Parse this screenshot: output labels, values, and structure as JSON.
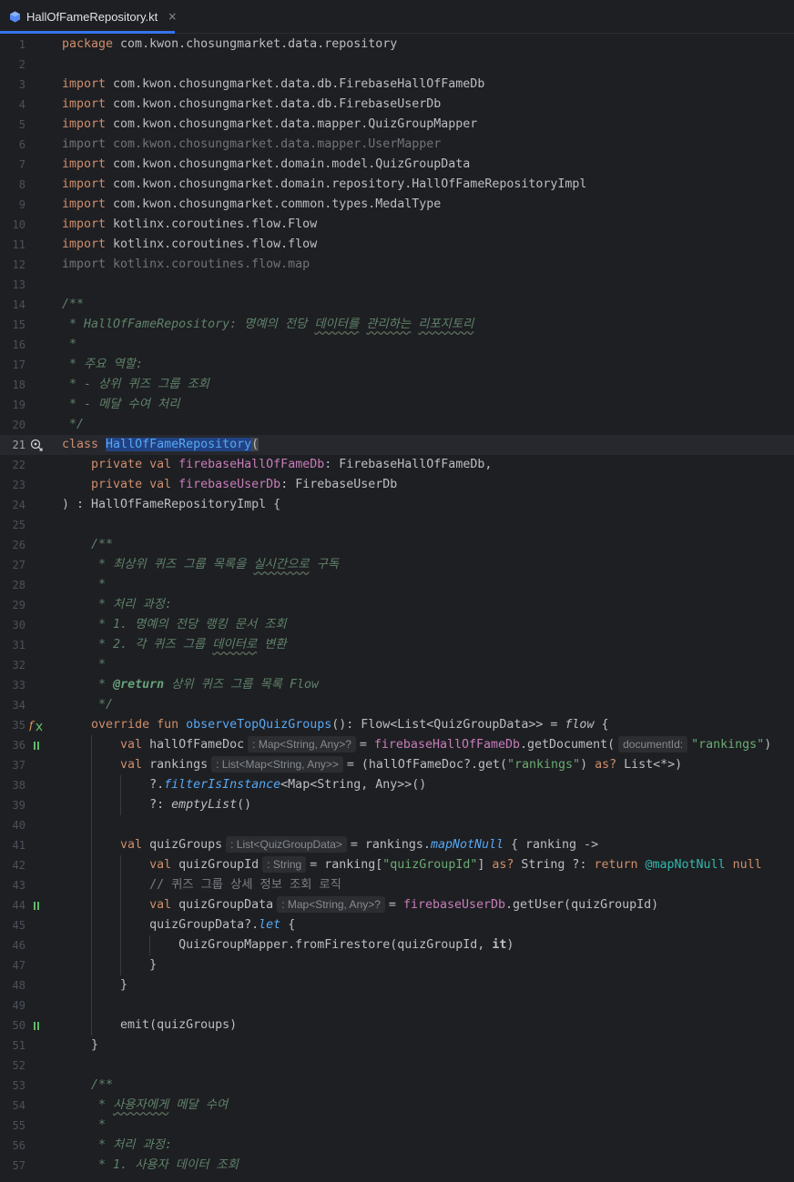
{
  "tab": {
    "filename": "HallOfFameRepository.kt",
    "close_glyph": "×",
    "icon": "kotlin-file-icon"
  },
  "lines": [
    {
      "n": "1",
      "code": [
        [
          "kw",
          "package"
        ],
        [
          "",
          "com.kwon.chosungmarket.data.repository"
        ]
      ]
    },
    {
      "n": "2",
      "code": []
    },
    {
      "n": "3",
      "code": [
        [
          "kw",
          "import"
        ],
        [
          "",
          "com.kwon.chosungmarket.data.db.FirebaseHallOfFameDb"
        ]
      ]
    },
    {
      "n": "4",
      "code": [
        [
          "kw",
          "import"
        ],
        [
          "",
          "com.kwon.chosungmarket.data.db.FirebaseUserDb"
        ]
      ]
    },
    {
      "n": "5",
      "code": [
        [
          "kw",
          "import"
        ],
        [
          "",
          "com.kwon.chosungmarket.data.mapper.QuizGroupMapper"
        ]
      ]
    },
    {
      "n": "6",
      "code": [
        [
          "dim",
          "import com.kwon.chosungmarket.data.mapper.UserMapper"
        ]
      ]
    },
    {
      "n": "7",
      "code": [
        [
          "kw",
          "import"
        ],
        [
          "",
          "com.kwon.chosungmarket.domain.model.QuizGroupData"
        ]
      ]
    },
    {
      "n": "8",
      "code": [
        [
          "kw",
          "import"
        ],
        [
          "",
          "com.kwon.chosungmarket.domain.repository.HallOfFameRepositoryImpl"
        ]
      ]
    },
    {
      "n": "9",
      "code": [
        [
          "kw",
          "import"
        ],
        [
          "",
          "com.kwon.chosungmarket.common.types.MedalType"
        ]
      ]
    },
    {
      "n": "10",
      "code": [
        [
          "kw",
          "import"
        ],
        [
          "",
          "kotlinx.coroutines.flow.Flow"
        ]
      ]
    },
    {
      "n": "11",
      "code": [
        [
          "kw",
          "import"
        ],
        [
          "",
          "kotlinx.coroutines.flow.flow"
        ]
      ]
    },
    {
      "n": "12",
      "code": [
        [
          "dim",
          "import kotlinx.coroutines.flow.map"
        ]
      ]
    },
    {
      "n": "13",
      "code": []
    },
    {
      "n": "14",
      "code": [
        [
          "cm",
          "/**"
        ]
      ]
    },
    {
      "n": "15",
      "code": [
        [
          "cm",
          " * HallOfFameRepository: 명예의 전당 "
        ],
        [
          "cm wavy",
          "데이터를"
        ],
        [
          "cm",
          " "
        ],
        [
          "cm wavy",
          "관리하는"
        ],
        [
          "cm",
          " "
        ],
        [
          "cm wavy",
          "리포지토리"
        ]
      ]
    },
    {
      "n": "16",
      "code": [
        [
          "cm",
          " *"
        ]
      ]
    },
    {
      "n": "17",
      "code": [
        [
          "cm",
          " * 주요 역할:"
        ]
      ]
    },
    {
      "n": "18",
      "code": [
        [
          "cm",
          " * - 상위 퀴즈 그룹 조회"
        ]
      ]
    },
    {
      "n": "19",
      "code": [
        [
          "cm",
          " * - 메달 수여 처리"
        ]
      ]
    },
    {
      "n": "20",
      "code": [
        [
          "cm",
          " */"
        ]
      ]
    },
    {
      "n": "21",
      "current": true,
      "gutter": "implemented-icon",
      "code": [
        [
          "kw",
          "class"
        ],
        [
          "",
          ""
        ],
        [
          "sel",
          "HallOfFameRepository"
        ],
        [
          "brace-hl",
          "("
        ]
      ]
    },
    {
      "n": "22",
      "code": [
        [
          "",
          "    "
        ],
        [
          "kw",
          "private val"
        ],
        [
          "",
          ""
        ],
        [
          "prop",
          "firebaseHallOfFameDb"
        ],
        [
          "",
          ": FirebaseHallOfFameDb,"
        ]
      ]
    },
    {
      "n": "23",
      "code": [
        [
          "",
          "    "
        ],
        [
          "kw",
          "private val"
        ],
        [
          "",
          ""
        ],
        [
          "prop",
          "firebaseUserDb"
        ],
        [
          "",
          ": FirebaseUserDb"
        ]
      ]
    },
    {
      "n": "24",
      "code": [
        [
          "",
          ") : HallOfFameRepositoryImpl {"
        ]
      ]
    },
    {
      "n": "25",
      "code": []
    },
    {
      "n": "26",
      "code": [
        [
          "",
          "    "
        ],
        [
          "cm",
          "/**"
        ]
      ]
    },
    {
      "n": "27",
      "code": [
        [
          "",
          "    "
        ],
        [
          "cm",
          " * 최상위 퀴즈 그룹 목록을 "
        ],
        [
          "cm wavy",
          "실시간으로"
        ],
        [
          "cm",
          " 구독"
        ]
      ]
    },
    {
      "n": "28",
      "code": [
        [
          "",
          "    "
        ],
        [
          "cm",
          " *"
        ]
      ]
    },
    {
      "n": "29",
      "code": [
        [
          "",
          "    "
        ],
        [
          "cm",
          " * 처리 과정:"
        ]
      ]
    },
    {
      "n": "30",
      "code": [
        [
          "",
          "    "
        ],
        [
          "cm",
          " * 1. 명예의 전당 랭킹 문서 조회"
        ]
      ]
    },
    {
      "n": "31",
      "code": [
        [
          "",
          "    "
        ],
        [
          "cm",
          " * 2. 각 퀴즈 그룹 "
        ],
        [
          "cm wavy",
          "데이터로"
        ],
        [
          "cm",
          " 변환"
        ]
      ]
    },
    {
      "n": "32",
      "code": [
        [
          "",
          "    "
        ],
        [
          "cm",
          " *"
        ]
      ]
    },
    {
      "n": "33",
      "code": [
        [
          "",
          "    "
        ],
        [
          "cm",
          " * "
        ],
        [
          "doctag",
          "@return"
        ],
        [
          "cm",
          " 상위 퀴즈 그룹 목록 Flow"
        ]
      ]
    },
    {
      "n": "34",
      "code": [
        [
          "",
          "    "
        ],
        [
          "cm",
          " */"
        ]
      ]
    },
    {
      "n": "35",
      "gutter": "override-suspend-icon",
      "code": [
        [
          "",
          "    "
        ],
        [
          "kw",
          "override fun"
        ],
        [
          "",
          ""
        ],
        [
          "fn",
          "observeTopQuizGroups"
        ],
        [
          "",
          "(): Flow<List<QuizGroupData>> = "
        ],
        [
          "ital",
          "flow"
        ],
        [
          "",
          " {"
        ]
      ]
    },
    {
      "n": "36",
      "gutter": "suspend-call-icon",
      "guides": [
        1
      ],
      "code": [
        [
          "",
          "        "
        ],
        [
          "kw",
          "val"
        ],
        [
          "",
          " hallOfFameDoc"
        ],
        [
          "hint",
          ": Map<String, Any>?"
        ],
        [
          "",
          "= "
        ],
        [
          "prop",
          "firebaseHallOfFameDb"
        ],
        [
          "",
          ".getDocument("
        ],
        [
          "hint",
          "documentId:"
        ],
        [
          "str",
          "\"rankings\""
        ],
        [
          "",
          ")"
        ]
      ]
    },
    {
      "n": "37",
      "guides": [
        1
      ],
      "code": [
        [
          "",
          "        "
        ],
        [
          "kw",
          "val"
        ],
        [
          "",
          " rankings"
        ],
        [
          "hint",
          ": List<Map<String, Any>>"
        ],
        [
          "",
          "= (hallOfFameDoc?.get("
        ],
        [
          "str",
          "\"rankings\""
        ],
        [
          "",
          ") "
        ],
        [
          "kw",
          "as?"
        ],
        [
          "",
          " List<*>)"
        ]
      ]
    },
    {
      "n": "38",
      "guides": [
        1,
        2
      ],
      "code": [
        [
          "",
          "            ?."
        ],
        [
          "ext",
          "filterIsInstance"
        ],
        [
          "",
          "<Map<String, Any>>()"
        ]
      ]
    },
    {
      "n": "39",
      "guides": [
        1,
        2
      ],
      "code": [
        [
          "",
          "            ?: "
        ],
        [
          "ital",
          "emptyList"
        ],
        [
          "",
          "()"
        ]
      ]
    },
    {
      "n": "40",
      "guides": [
        1
      ],
      "code": []
    },
    {
      "n": "41",
      "guides": [
        1
      ],
      "code": [
        [
          "",
          "        "
        ],
        [
          "kw",
          "val"
        ],
        [
          "",
          " quizGroups"
        ],
        [
          "hint",
          ": List<QuizGroupData>"
        ],
        [
          "",
          "= rankings."
        ],
        [
          "ext",
          "mapNotNull"
        ],
        [
          "",
          " { ranking ->"
        ]
      ]
    },
    {
      "n": "42",
      "guides": [
        1,
        2
      ],
      "code": [
        [
          "",
          "            "
        ],
        [
          "kw",
          "val"
        ],
        [
          "",
          " quizGroupId"
        ],
        [
          "hint",
          ": String"
        ],
        [
          "",
          "= ranking["
        ],
        [
          "str",
          "\"quizGroupId\""
        ],
        [
          "",
          "] "
        ],
        [
          "kw",
          "as?"
        ],
        [
          "",
          " String ?: "
        ],
        [
          "kw",
          "return"
        ],
        [
          "lbl",
          "@mapNotNull"
        ],
        [
          "",
          ""
        ],
        [
          "kw",
          "null"
        ]
      ]
    },
    {
      "n": "43",
      "guides": [
        1,
        2
      ],
      "code": [
        [
          "",
          "            "
        ],
        [
          "lcm",
          "// 퀴즈 그룹 상세 정보 조회 로직"
        ]
      ]
    },
    {
      "n": "44",
      "gutter": "suspend-call-icon",
      "guides": [
        1,
        2
      ],
      "code": [
        [
          "",
          "            "
        ],
        [
          "kw",
          "val"
        ],
        [
          "",
          " quizGroupData"
        ],
        [
          "hint",
          ": Map<String, Any>?"
        ],
        [
          "",
          "= "
        ],
        [
          "prop",
          "firebaseUserDb"
        ],
        [
          "",
          ".getUser(quizGroupId)"
        ]
      ]
    },
    {
      "n": "45",
      "guides": [
        1,
        2
      ],
      "code": [
        [
          "",
          "            quizGroupData?."
        ],
        [
          "ext",
          "let"
        ],
        [
          "",
          " {"
        ]
      ]
    },
    {
      "n": "46",
      "guides": [
        1,
        2,
        3
      ],
      "code": [
        [
          "",
          "                QuizGroupMapper.fromFirestore(quizGroupId, "
        ],
        [
          "bold",
          "it"
        ],
        [
          "",
          ")"
        ]
      ]
    },
    {
      "n": "47",
      "guides": [
        1,
        2
      ],
      "code": [
        [
          "",
          "            }"
        ]
      ]
    },
    {
      "n": "48",
      "guides": [
        1
      ],
      "code": [
        [
          "",
          "        }"
        ]
      ]
    },
    {
      "n": "49",
      "guides": [
        1
      ],
      "code": []
    },
    {
      "n": "50",
      "gutter": "suspend-call-icon",
      "guides": [
        1
      ],
      "code": [
        [
          "",
          "        emit(quizGroups)"
        ]
      ]
    },
    {
      "n": "51",
      "code": [
        [
          "",
          "    }"
        ]
      ]
    },
    {
      "n": "52",
      "code": []
    },
    {
      "n": "53",
      "code": [
        [
          "",
          "    "
        ],
        [
          "cm",
          "/**"
        ]
      ]
    },
    {
      "n": "54",
      "code": [
        [
          "",
          "    "
        ],
        [
          "cm",
          " * "
        ],
        [
          "cm wavy",
          "사용자에게"
        ],
        [
          "cm",
          " 메달 수여"
        ]
      ]
    },
    {
      "n": "55",
      "code": [
        [
          "",
          "    "
        ],
        [
          "cm",
          " *"
        ]
      ]
    },
    {
      "n": "56",
      "code": [
        [
          "",
          "    "
        ],
        [
          "cm",
          " * 처리 과정:"
        ]
      ]
    },
    {
      "n": "57",
      "code": [
        [
          "",
          "    "
        ],
        [
          "cm",
          " * 1. 사용자 데이터 조회"
        ]
      ]
    }
  ]
}
